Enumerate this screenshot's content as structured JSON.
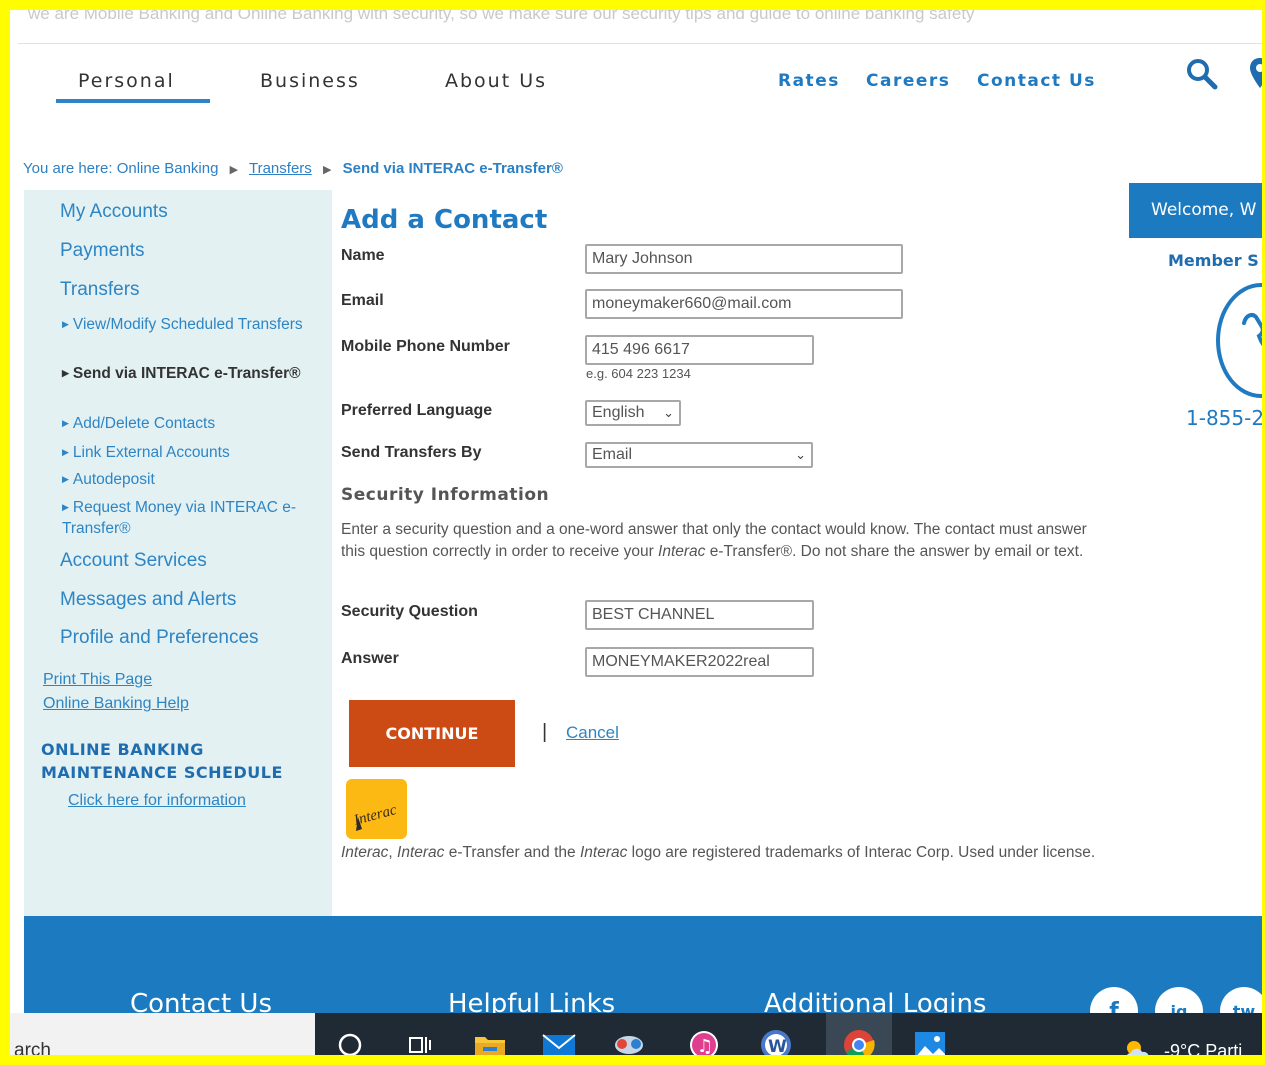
{
  "top_strip": {
    "text": "we are Mobile Banking and Online Banking with security, so we make sure our security tips and guide to online banking safety"
  },
  "nav": {
    "items": [
      "Personal",
      "Business",
      "About Us"
    ],
    "utility": [
      "Rates",
      "Careers",
      "Contact Us"
    ]
  },
  "breadcrumb": {
    "prefix": "You are here:",
    "online_banking": "Online Banking",
    "transfers": "Transfers",
    "current": "Send via INTERAC e-Transfer®"
  },
  "sidebar": {
    "main_top": [
      "My Accounts",
      "Payments",
      "Transfers"
    ],
    "transfers_sub": [
      "View/Modify Scheduled Transfers",
      "Send via INTERAC e-Transfer®",
      "Add/Delete Contacts",
      "Link External Accounts",
      "Autodeposit",
      "Request Money via INTERAC e-Transfer®"
    ],
    "main_bottom": [
      "Account Services",
      "Messages and Alerts",
      "Profile and Preferences"
    ],
    "print": "Print This Page",
    "help": "Online Banking Help",
    "maintenance_title": "ONLINE BANKING MAINTENANCE SCHEDULE",
    "maintenance_link": "Click here for information"
  },
  "form": {
    "title": "Add a Contact",
    "name_label": "Name",
    "name_value": "Mary Johnson",
    "email_label": "Email",
    "email_value": "moneymaker660@mail.com",
    "phone_label": "Mobile Phone Number",
    "phone_value": "415 496 6617",
    "phone_hint": "e.g. 604 223 1234",
    "lang_label": "Preferred Language",
    "lang_value": "English",
    "send_label": "Send Transfers By",
    "send_value": "Email",
    "security_title": "Security Information",
    "security_desc_1": "Enter a security question and a one-word answer that only the contact would know. The contact must answer this question correctly in order to receive your ",
    "security_desc_interac": "Interac",
    "security_desc_2": " e-Transfer®. Do not share the answer by email or text.",
    "question_label": "Security Question",
    "question_value": "BEST CHANNEL",
    "answer_label": "Answer",
    "answer_value": "MONEYMAKER2022real",
    "continue": "CONTINUE",
    "separator": "|",
    "cancel": "Cancel",
    "logo_text": "Interac",
    "tm_1": "Interac",
    "tm_2": ", ",
    "tm_3": "Interac",
    "tm_4": " e-Transfer and the ",
    "tm_5": "Interac",
    "tm_6": " logo are registered trademarks of Interac Corp. Used under license."
  },
  "right_panel": {
    "welcome": "Welcome, W",
    "member": "Member S",
    "phone": "1-855-2"
  },
  "footer": {
    "headings": [
      "Contact Us",
      "Helpful Links",
      "Additional Logins"
    ],
    "social": [
      "f",
      "ig",
      "tw"
    ]
  },
  "taskbar": {
    "search": "arch",
    "weather": "-9°C Parti"
  },
  "colors": {
    "accent": "#1c7bc0",
    "continue": "#cc4b14",
    "sidebar_bg": "#e4f1f3",
    "frame": "#fffd00",
    "interac": "#fdb913"
  }
}
